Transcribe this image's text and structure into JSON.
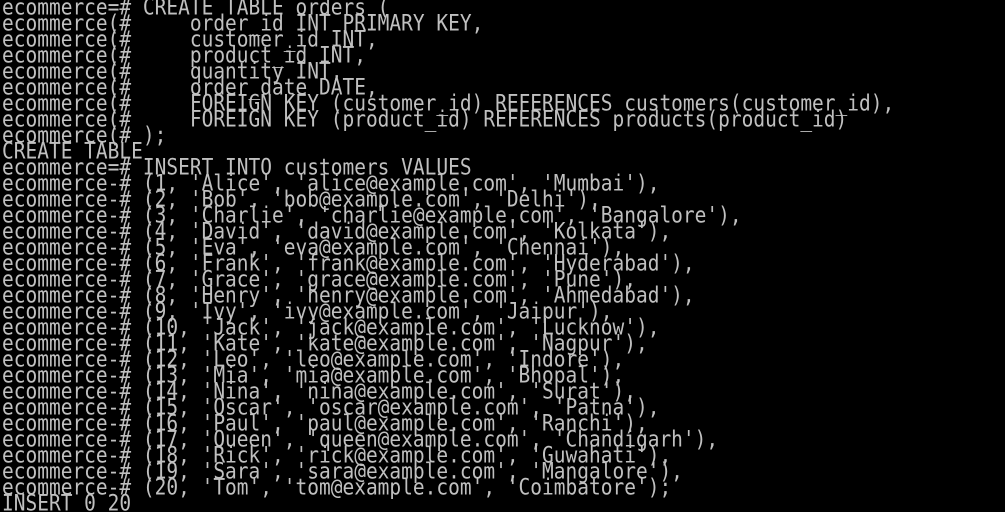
{
  "colors": {
    "background": "#000000",
    "foreground": "#c0c0c0"
  },
  "terminal": {
    "lines": [
      "ecommerce=# CREATE TABLE orders (",
      "ecommerce(#     order_id INT PRIMARY KEY,",
      "ecommerce(#     customer_id INT,",
      "ecommerce(#     product_id INT,",
      "ecommerce(#     quantity INT,",
      "ecommerce(#     order_date DATE,",
      "ecommerce(#     FOREIGN KEY (customer_id) REFERENCES customers(customer_id),",
      "ecommerce(#     FOREIGN KEY (product_id) REFERENCES products(product_id)",
      "ecommerce(# );",
      "CREATE TABLE",
      "ecommerce=# INSERT INTO customers VALUES",
      "ecommerce-# (1, 'Alice', 'alice@example.com', 'Mumbai'),",
      "ecommerce-# (2, 'Bob', 'bob@example.com', 'Delhi'),",
      "ecommerce-# (3, 'Charlie', 'charlie@example.com', 'Bangalore'),",
      "ecommerce-# (4, 'David', 'david@example.com', 'Kolkata'),",
      "ecommerce-# (5, 'Eva', 'eva@example.com', 'Chennai'),",
      "ecommerce-# (6, 'Frank', 'frank@example.com', 'Hyderabad'),",
      "ecommerce-# (7, 'Grace', 'grace@example.com', 'Pune'),",
      "ecommerce-# (8, 'Henry', 'henry@example.com', 'Ahmedabad'),",
      "ecommerce-# (9, 'Ivy', 'ivy@example.com', 'Jaipur'),",
      "ecommerce-# (10, 'Jack', 'jack@example.com', 'Lucknow'),",
      "ecommerce-# (11, 'Kate', 'kate@example.com', 'Nagpur'),",
      "ecommerce-# (12, 'Leo', 'leo@example.com', 'Indore'),",
      "ecommerce-# (13, 'Mia', 'mia@example.com', 'Bhopal'),",
      "ecommerce-# (14, 'Nina', 'nina@example.com', 'Surat'),",
      "ecommerce-# (15, 'Oscar', 'oscar@example.com', 'Patna'),",
      "ecommerce-# (16, 'Paul', 'paul@example.com', 'Ranchi'),",
      "ecommerce-# (17, 'Queen', 'queen@example.com', 'Chandigarh'),",
      "ecommerce-# (18, 'Rick', 'rick@example.com', 'Guwahati'),",
      "ecommerce-# (19, 'Sara', 'sara@example.com', 'Mangalore'),",
      "ecommerce-# (20, 'Tom', 'tom@example.com', 'Coimbatore');",
      "INSERT 0 20"
    ]
  }
}
